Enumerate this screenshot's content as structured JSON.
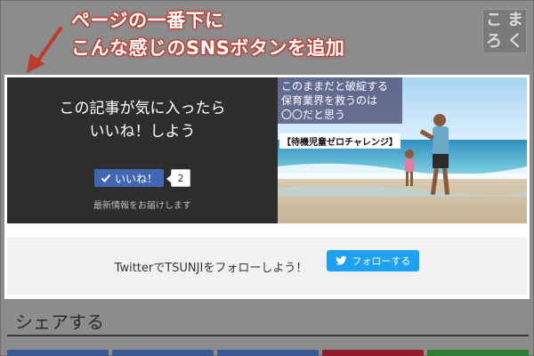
{
  "annotation": {
    "line1": "ページの一番下に",
    "line2": "こんな感じのSNSボタンを追加"
  },
  "logo": {
    "chars": [
      "こ",
      "ま",
      "ろ",
      "く"
    ]
  },
  "like_panel": {
    "heading_line1": "この記事が気に入ったら",
    "heading_line2": "いいね！しよう",
    "like_label": "いいね！",
    "like_count": "2",
    "subtext": "最新情報をお届けします"
  },
  "photo": {
    "caption_line1": "このままだと破綻する",
    "caption_line2": "保育業界を救うのは",
    "caption_line3": "〇〇だと思う",
    "tag": "【待機児童ゼロチャレンジ】"
  },
  "twitter": {
    "text": "TwitterでTSUNJIをフォローしよう！",
    "follow_label": "フォローする"
  },
  "share": {
    "title": "シェアする",
    "buttons": [
      {
        "name": "share-button-1",
        "color": "#3b5998"
      },
      {
        "name": "share-button-2",
        "color": "#3b5998"
      },
      {
        "name": "share-button-3",
        "color": "#3b5998"
      },
      {
        "name": "share-button-4",
        "color": "#8f1d2c"
      },
      {
        "name": "share-button-5",
        "color": "#2e7d32"
      }
    ]
  },
  "colors": {
    "background": "#8c8c8c",
    "annotation_outline": "#c0392b",
    "facebook_blue": "#4267b2",
    "twitter_blue": "#1da1f2"
  }
}
